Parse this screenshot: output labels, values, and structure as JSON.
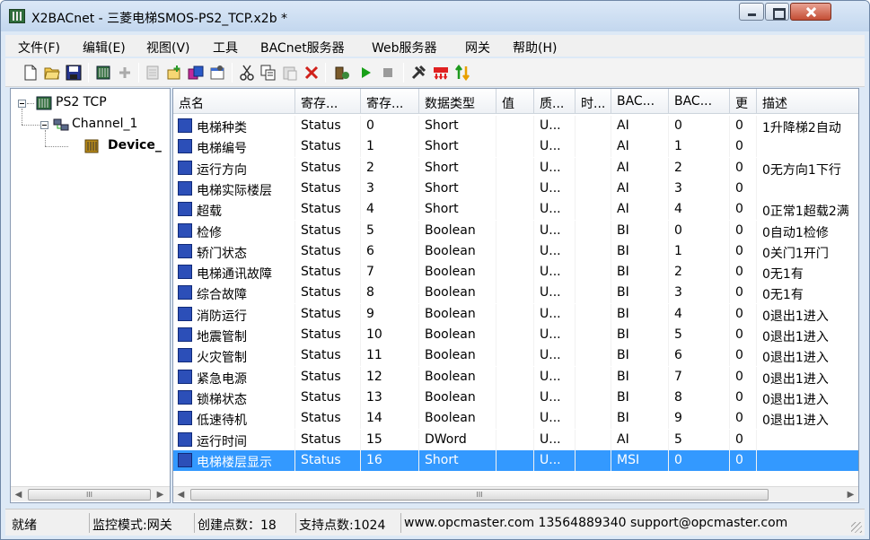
{
  "window": {
    "title": "X2BACnet - 三菱电梯SMOS-PS2_TCP.x2b *"
  },
  "menu": [
    "文件(F)",
    "编辑(E)",
    "视图(V)",
    "工具",
    "BACnet服务器",
    "Web服务器",
    "网关",
    "帮助(H)"
  ],
  "toolbar": {
    "icons": [
      "new-file-icon",
      "open-folder-icon",
      "save-icon",
      "channel-icon",
      "device-gray-icon",
      "doc-gray-icon",
      "add-point-icon",
      "import-icon",
      "properties-icon",
      "cut-icon",
      "copy-icon",
      "paste-icon",
      "delete-icon",
      "debug-icon",
      "run-icon",
      "stop-icon",
      "tools-icon",
      "load-icon",
      "sync-icon"
    ]
  },
  "tree": {
    "root": "PS2 TCP",
    "channel": "Channel_1",
    "device": "Device_"
  },
  "table": {
    "columns": [
      "点名",
      "寄存...",
      "寄存...",
      "数据类型",
      "值",
      "质...",
      "时...",
      "BAC...",
      "BAC...",
      "更",
      "描述"
    ],
    "rows": [
      [
        "电梯种类",
        "Status",
        "0",
        "Short",
        "",
        "U...",
        "",
        "AI",
        "0",
        "0",
        "1升降梯2自动"
      ],
      [
        "电梯编号",
        "Status",
        "1",
        "Short",
        "",
        "U...",
        "",
        "AI",
        "1",
        "0",
        ""
      ],
      [
        "运行方向",
        "Status",
        "2",
        "Short",
        "",
        "U...",
        "",
        "AI",
        "2",
        "0",
        "0无方向1下行"
      ],
      [
        "电梯实际楼层",
        "Status",
        "3",
        "Short",
        "",
        "U...",
        "",
        "AI",
        "3",
        "0",
        ""
      ],
      [
        "超载",
        "Status",
        "4",
        "Short",
        "",
        "U...",
        "",
        "AI",
        "4",
        "0",
        "0正常1超载2满"
      ],
      [
        "检修",
        "Status",
        "5",
        "Boolean",
        "",
        "U...",
        "",
        "BI",
        "0",
        "0",
        "0自动1检修"
      ],
      [
        "轿门状态",
        "Status",
        "6",
        "Boolean",
        "",
        "U...",
        "",
        "BI",
        "1",
        "0",
        "0关门1开门"
      ],
      [
        "电梯通讯故障",
        "Status",
        "7",
        "Boolean",
        "",
        "U...",
        "",
        "BI",
        "2",
        "0",
        "0无1有"
      ],
      [
        "综合故障",
        "Status",
        "8",
        "Boolean",
        "",
        "U...",
        "",
        "BI",
        "3",
        "0",
        "0无1有"
      ],
      [
        "消防运行",
        "Status",
        "9",
        "Boolean",
        "",
        "U...",
        "",
        "BI",
        "4",
        "0",
        "0退出1进入"
      ],
      [
        "地震管制",
        "Status",
        "10",
        "Boolean",
        "",
        "U...",
        "",
        "BI",
        "5",
        "0",
        "0退出1进入"
      ],
      [
        "火灾管制",
        "Status",
        "11",
        "Boolean",
        "",
        "U...",
        "",
        "BI",
        "6",
        "0",
        "0退出1进入"
      ],
      [
        "紧急电源",
        "Status",
        "12",
        "Boolean",
        "",
        "U...",
        "",
        "BI",
        "7",
        "0",
        "0退出1进入"
      ],
      [
        "锁梯状态",
        "Status",
        "13",
        "Boolean",
        "",
        "U...",
        "",
        "BI",
        "8",
        "0",
        "0退出1进入"
      ],
      [
        "低速待机",
        "Status",
        "14",
        "Boolean",
        "",
        "U...",
        "",
        "BI",
        "9",
        "0",
        "0退出1进入"
      ],
      [
        "运行时间",
        "Status",
        "15",
        "DWord",
        "",
        "U...",
        "",
        "AI",
        "5",
        "0",
        ""
      ],
      [
        "电梯楼层显示",
        "Status",
        "16",
        "Short",
        "",
        "U...",
        "",
        "MSI",
        "0",
        "0",
        ""
      ]
    ],
    "selected_row": 16
  },
  "status": {
    "ready": "就绪",
    "mode": "监控模式:网关",
    "created_points": "创建点数：18",
    "supported_points": "支持点数:1024",
    "contact": "www.opcmaster.com 13564889340 support@opcmaster.com"
  },
  "scrollbar": {
    "thumb_label": "III"
  }
}
